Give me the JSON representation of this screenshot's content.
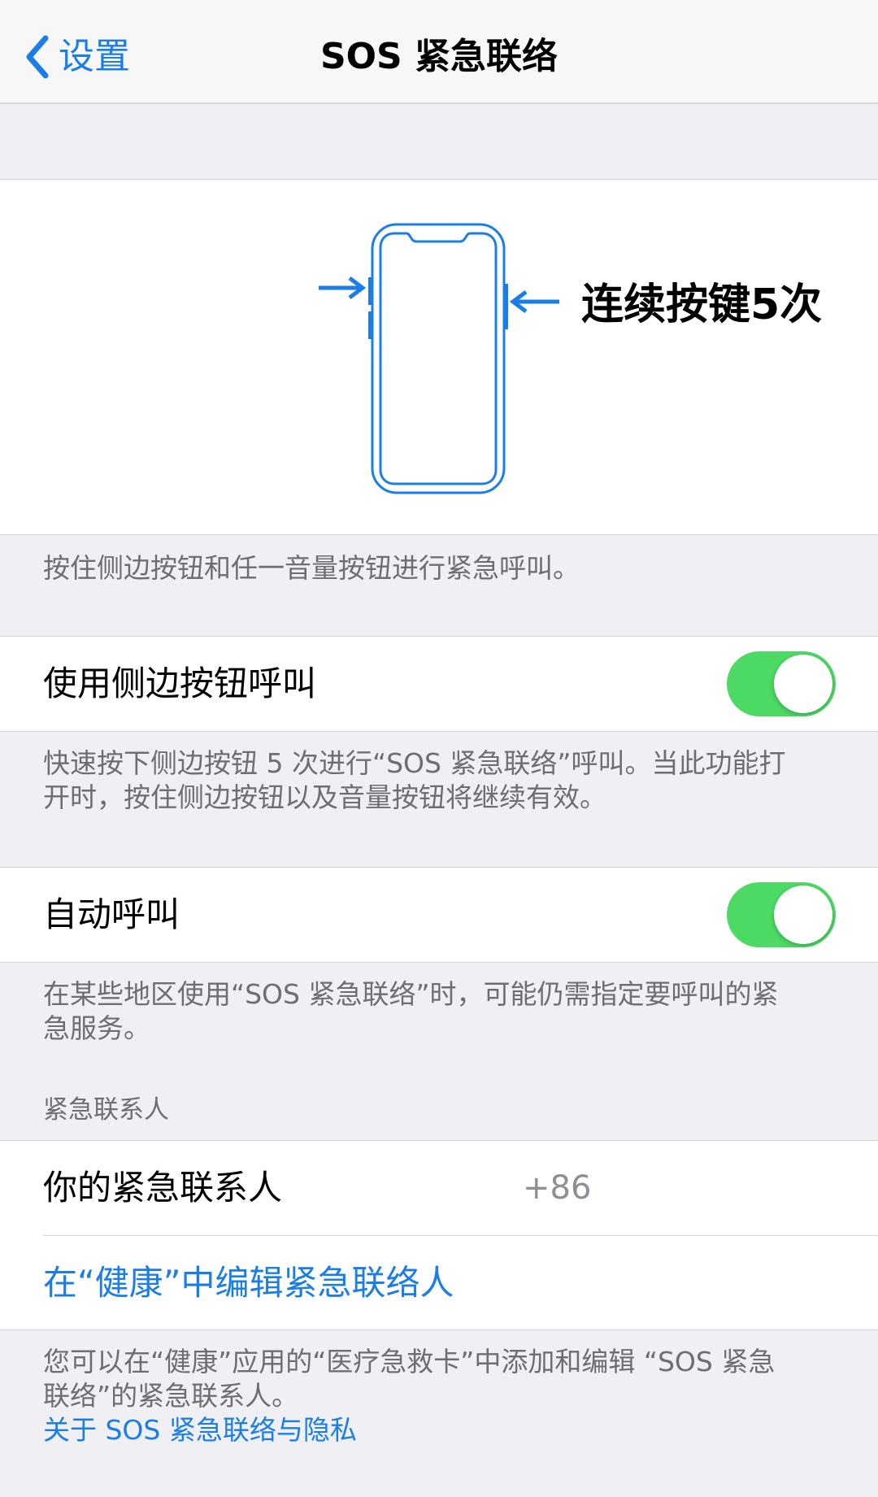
{
  "nav": {
    "back_label": "设置",
    "title": "SOS 紧急联络"
  },
  "illustration": {
    "label": "连续按键5次",
    "accent_color": "#1a7ee6"
  },
  "hold_note": "按住侧边按钮和任一音量按钮进行紧急呼叫。",
  "side_button_call": {
    "label": "使用侧边按钮呼叫",
    "enabled": true,
    "footnote_line1": "快速按下侧边按钮 5 次进行“SOS 紧急联络”呼叫。当此功能打",
    "footnote_line2": "开时，按住侧边按钮以及音量按钮将继续有效。"
  },
  "auto_call": {
    "label": "自动呼叫",
    "enabled": true,
    "footnote_line1": "在某些地区使用“SOS 紧急联络”时，可能仍需指定要呼叫的紧",
    "footnote_line2": "急服务。"
  },
  "contacts": {
    "header": "紧急联系人",
    "row_label": "你的紧急联系人",
    "row_value": "+86",
    "edit_link": "在“健康”中编辑紧急联络人",
    "footnote_line1": "您可以在“健康”应用的“医疗急救卡”中添加和编辑 “SOS 紧急",
    "footnote_line2": "联络”的紧急联系人。",
    "privacy_link": "关于 SOS 紧急联络与隐私"
  },
  "colors": {
    "toggle_on": "#4cd964",
    "link": "#1a7ee6",
    "background": "#efeff4"
  }
}
